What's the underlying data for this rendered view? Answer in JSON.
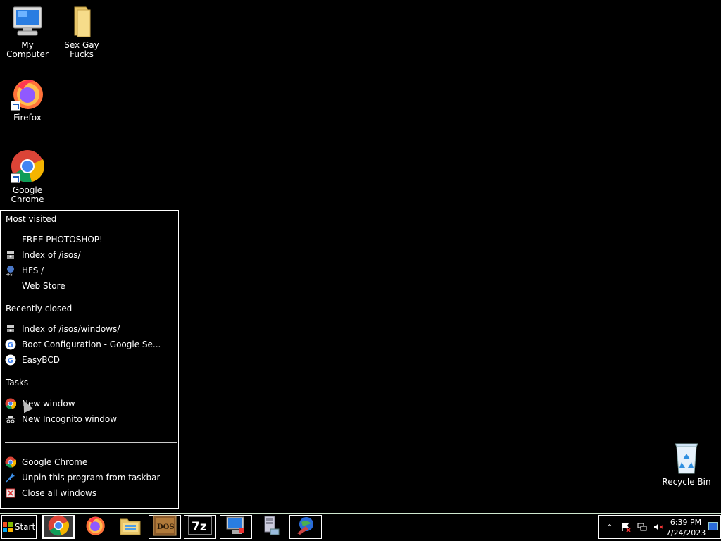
{
  "desktop": {
    "icons": [
      {
        "label": "My Computer",
        "icon": "my-computer-icon"
      },
      {
        "label": "Sex Gay Fucks",
        "icon": "folder-icon"
      },
      {
        "label": "Firefox",
        "icon": "firefox-icon"
      },
      {
        "label": "Google Chrome",
        "icon": "chrome-icon"
      },
      {
        "label": "Recycle Bin",
        "icon": "recycle-bin-icon"
      }
    ]
  },
  "jumplist": {
    "sections": {
      "most_visited": "Most visited",
      "recently_closed": "Recently closed",
      "tasks": "Tasks"
    },
    "most_visited": [
      {
        "label": "FREE PHOTOSHOP!",
        "icon": ""
      },
      {
        "label": "Index of /isos/",
        "icon": "server-icon"
      },
      {
        "label": "HFS /",
        "icon": "hfs-icon"
      },
      {
        "label": "Web Store",
        "icon": ""
      }
    ],
    "recently_closed": [
      {
        "label": "Index of /isos/windows/",
        "icon": "server-icon"
      },
      {
        "label": "Boot Configuration - Google Se...",
        "icon": "google-icon"
      },
      {
        "label": "EasyBCD",
        "icon": "google-icon"
      }
    ],
    "tasks": [
      {
        "label": "New window",
        "icon": "chrome-icon"
      },
      {
        "label": "New Incognito window",
        "icon": "incognito-icon"
      }
    ],
    "footer": [
      {
        "label": "Google Chrome",
        "icon": "chrome-icon"
      },
      {
        "label": "Unpin this program from taskbar",
        "icon": "unpin-icon"
      },
      {
        "label": "Close all windows",
        "icon": "close-windows-icon"
      }
    ]
  },
  "taskbar": {
    "start_label": "Start",
    "pinned": [
      {
        "name": "chrome",
        "icon": "chrome-icon",
        "active": true
      },
      {
        "name": "firefox",
        "icon": "firefox-icon",
        "active": false
      },
      {
        "name": "explorer",
        "icon": "explorer-icon",
        "active": false
      },
      {
        "name": "dosbox",
        "icon": "dosbox-icon",
        "active": false
      },
      {
        "name": "7zip",
        "icon": "7zip-icon",
        "active": false
      },
      {
        "name": "computer-app",
        "icon": "computer-app-icon",
        "active": false
      },
      {
        "name": "network-server",
        "icon": "server-app-icon",
        "active": false
      },
      {
        "name": "globe-app",
        "icon": "globe-app-icon",
        "active": false
      }
    ],
    "dosbox_text": "DOS",
    "sevenzip_text": "7z"
  },
  "tray": {
    "time": "6:39 PM",
    "date": "7/24/2023",
    "icons": [
      "show-hidden-icon",
      "action-center-icon",
      "network-icon",
      "volume-muted-icon"
    ]
  },
  "colors": {
    "background": "#000000",
    "text": "#ffffff",
    "chrome_red": "#db4437",
    "chrome_green": "#0f9d58",
    "chrome_yellow": "#f4b400",
    "chrome_blue": "#4285f4"
  }
}
